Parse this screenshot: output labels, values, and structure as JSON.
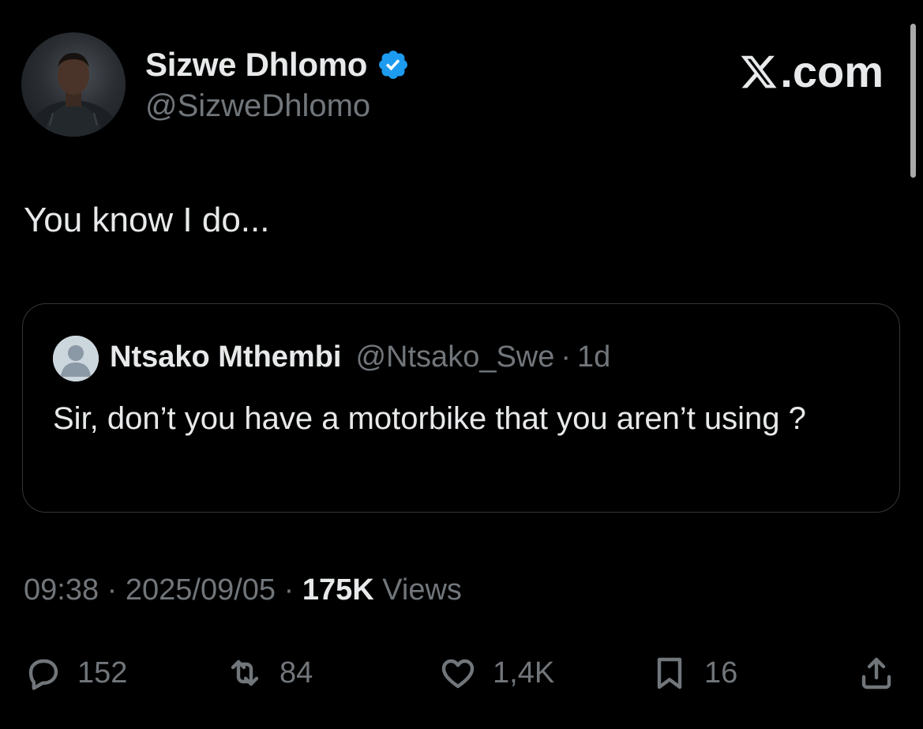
{
  "author": {
    "display_name": "Sizwe Dhlomo",
    "handle": "@SizweDhlomo",
    "verified": true
  },
  "brand": {
    "label": ".com"
  },
  "tweet": {
    "text": "You know I do..."
  },
  "quote": {
    "display_name": "Ntsako Mthembi",
    "handle": "@Ntsako_Swe",
    "separator": "·",
    "age": "1d",
    "text": "Sir, don’t you have a motorbike that you aren’t using ?"
  },
  "meta": {
    "time": "09:38",
    "sep1": " · ",
    "date": "2025/09/05",
    "sep2": " · ",
    "views_count": "175K",
    "views_label": " Views"
  },
  "actions": {
    "replies": "152",
    "reposts": "84",
    "likes": "1,4K",
    "bookmarks": "16"
  },
  "colors": {
    "background": "#000000",
    "text_primary": "#e7e9ea",
    "text_secondary": "#71767b",
    "verified_blue": "#1d9bf0",
    "border": "#333639"
  }
}
